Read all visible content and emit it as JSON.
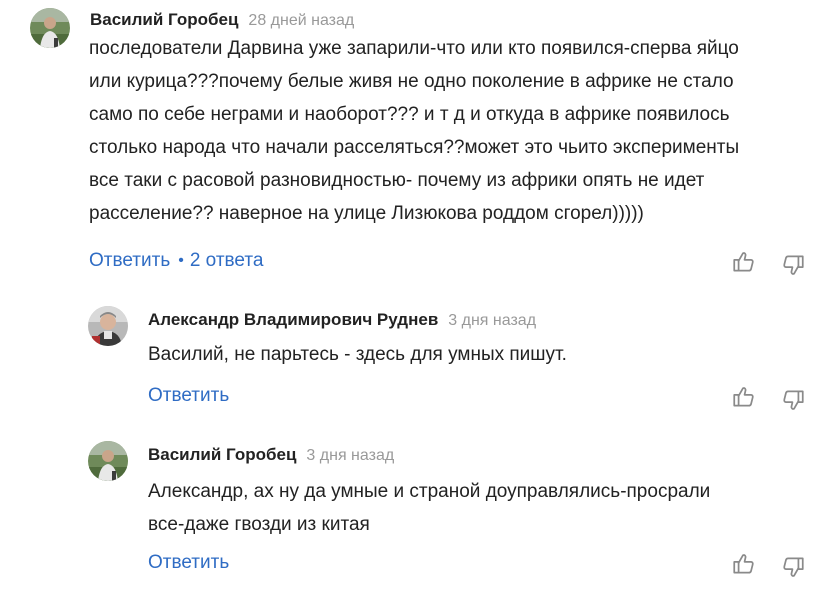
{
  "thread": {
    "comment": {
      "author": "Василий Горобец",
      "time": "28 дней назад",
      "lines": [
        "последователи Дарвина уже запарили-что или кто появился-сперва яйцо",
        "или курица???почему белые живя не одно поколение в африке не стало",
        "само по себе неграми и наоборот??? и т д и откуда в африке появилось",
        "столько народа что начали расселяться??может это чьито эксперименты",
        "все таки с расовой разновидностью- почему из африки опять не идет",
        "расселение?? наверное на улице Лизюкова роддом сгорел)))))"
      ],
      "reply_label": "Ответить",
      "separator": "•",
      "replies_label": "2 ответа"
    },
    "replies": [
      {
        "author": "Александр Владимирович Руднев",
        "time": "3 дня назад",
        "lines": [
          "Василий, не парьтесь - здесь для умных пишут."
        ],
        "reply_label": "Ответить"
      },
      {
        "author": "Василий Горобец",
        "time": "3 дня назад",
        "lines": [
          "Александр, ах ну да умные и страной доуправлялись-просрали",
          "все-даже гвозди из китая"
        ],
        "reply_label": "Ответить"
      }
    ]
  },
  "icons": {
    "like": "thumbs-up-icon",
    "dislike": "thumbs-down-icon"
  },
  "colors": {
    "link": "#2f6cc4",
    "text": "#222222",
    "muted": "#999999",
    "icon": "#8a8a8a"
  }
}
